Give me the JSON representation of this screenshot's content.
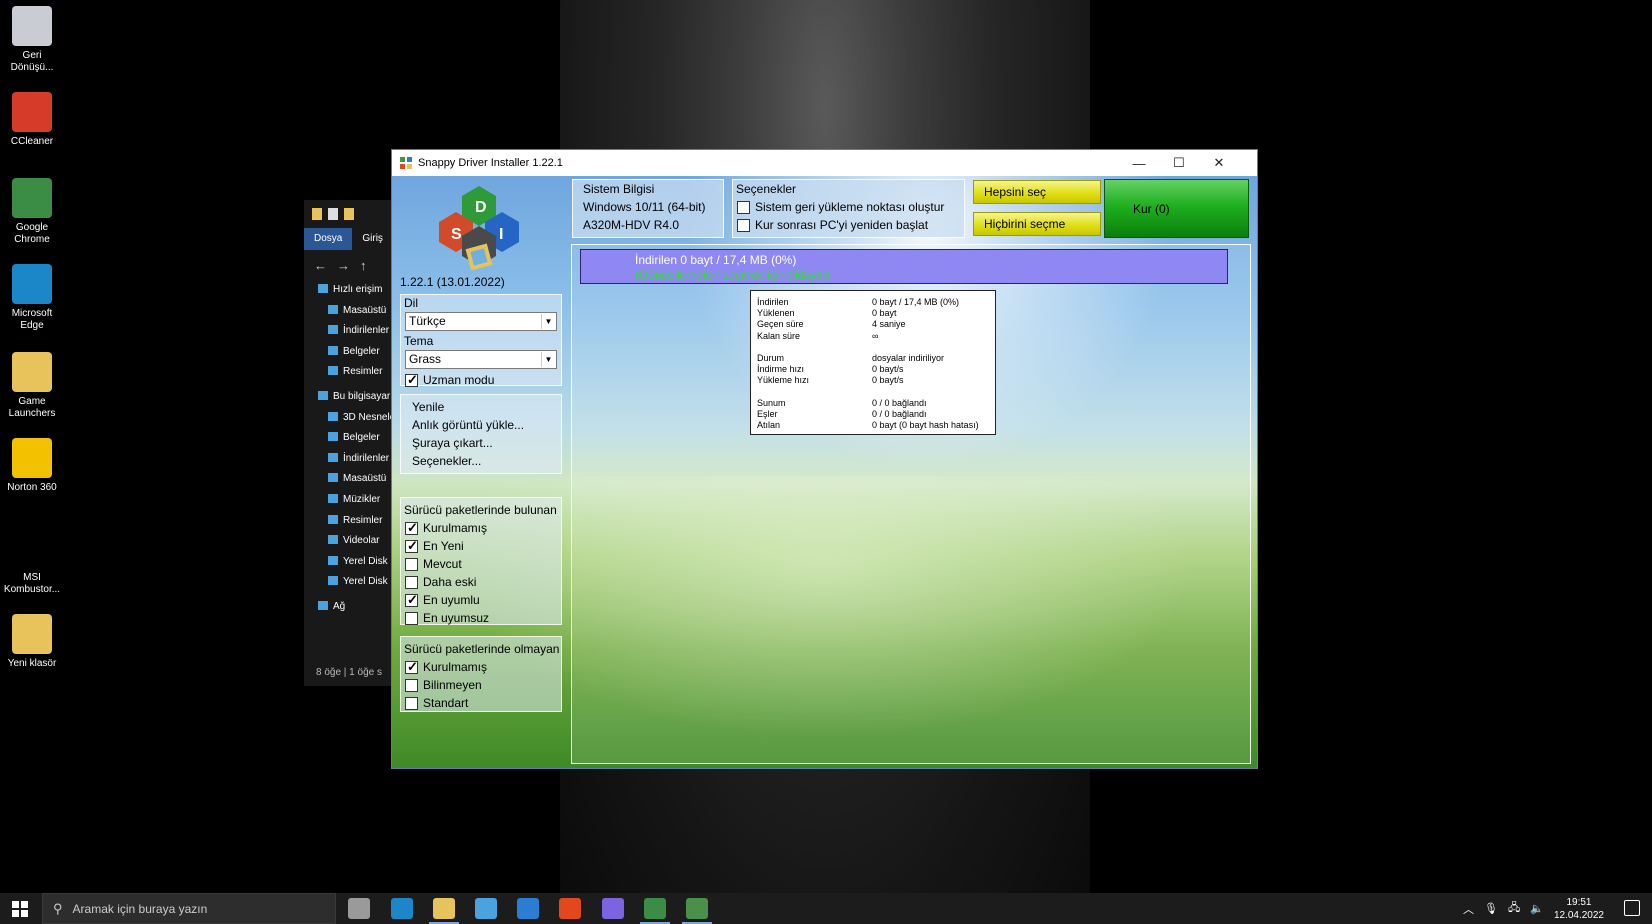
{
  "desktop": {
    "icons": [
      {
        "label": "Geri Dönüşü...",
        "color": "#c9ccd2"
      },
      {
        "label": "CCleaner",
        "color": "#d63b2a"
      },
      {
        "label": "Google Chrome",
        "color": "#3b8d45"
      },
      {
        "label": "Microsoft Edge",
        "color": "#1b87c9"
      },
      {
        "label": "Game Launchers",
        "color": "#e8c25a"
      },
      {
        "label": "Norton 360",
        "color": "#f2c200"
      },
      {
        "label": "MSI Kombustor...",
        "color": "#000000"
      },
      {
        "label": "Yeni klasör",
        "color": "#e8c25a"
      }
    ]
  },
  "explorer": {
    "tabs": [
      "Dosya",
      "Giriş"
    ],
    "tree": [
      {
        "label": "Hızlı erişim",
        "level": 0
      },
      {
        "label": "Masaüstü",
        "level": 1
      },
      {
        "label": "İndirilenler",
        "level": 1
      },
      {
        "label": "Belgeler",
        "level": 1
      },
      {
        "label": "Resimler",
        "level": 1
      },
      {
        "label": "Bu bilgisayar",
        "level": 0
      },
      {
        "label": "3D Nesneler",
        "level": 1
      },
      {
        "label": "Belgeler",
        "level": 1
      },
      {
        "label": "İndirilenler",
        "level": 1
      },
      {
        "label": "Masaüstü",
        "level": 1
      },
      {
        "label": "Müzikler",
        "level": 1
      },
      {
        "label": "Resimler",
        "level": 1
      },
      {
        "label": "Videolar",
        "level": 1
      },
      {
        "label": "Yerel Disk",
        "level": 1
      },
      {
        "label": "Yerel Disk",
        "level": 1
      },
      {
        "label": "Ağ",
        "level": 0
      }
    ],
    "status": "8 öğe  |  1 öğe s"
  },
  "sdi": {
    "title": "Snappy Driver Installer 1.22.1",
    "version": "1.22.1 (13.01.2022)",
    "language": {
      "label": "Dil",
      "value": "Türkçe"
    },
    "theme": {
      "label": "Tema",
      "value": "Grass"
    },
    "expert_mode": {
      "label": "Uzman modu",
      "checked": true
    },
    "menu": [
      "Yenile",
      "Anlık görüntü yükle...",
      "Şuraya çıkart...",
      "Seçenekler..."
    ],
    "found_section": {
      "title": "Sürücü paketlerinde bulunan",
      "items": [
        {
          "label": "Kurulmamış",
          "checked": true
        },
        {
          "label": "En Yeni",
          "checked": true
        },
        {
          "label": "Mevcut",
          "checked": false
        },
        {
          "label": "Daha eski",
          "checked": false
        },
        {
          "label": "En uyumlu",
          "checked": true
        },
        {
          "label": "En uyumsuz",
          "checked": false
        }
      ]
    },
    "missing_section": {
      "title": "Sürücü paketlerinde olmayan",
      "items": [
        {
          "label": "Kurulmamış",
          "checked": true
        },
        {
          "label": "Bilinmeyen",
          "checked": false
        },
        {
          "label": "Standart",
          "checked": false
        }
      ]
    },
    "system_info": {
      "title": "Sistem Bilgisi",
      "os": "Windows 10/11 (64-bit)",
      "board": "A320M-HDV R4.0"
    },
    "options": {
      "title": "Seçenekler",
      "restore_point": {
        "label": "Sistem geri yükleme noktası oluştur",
        "checked": false
      },
      "restart": {
        "label": "Kur sonrası PC'yi yeniden başlat",
        "checked": false
      }
    },
    "select_all": "Hepsini seç",
    "select_none": "Hiçbirini seçme",
    "install": "Kur (0)",
    "progress": {
      "line1": "İndirilen 0 bayt / 17,4 MB (0%)",
      "line2": "(Güncellemeleri seçmek için tıklayın)"
    },
    "stats": [
      {
        "k": "İndirilen",
        "v": "0 bayt / 17,4 MB (0%)"
      },
      {
        "k": "Yüklenen",
        "v": "0 bayt"
      },
      {
        "k": "Geçen süre",
        "v": "4 saniye"
      },
      {
        "k": "Kalan süre",
        "v": "∞"
      },
      {
        "gap": true
      },
      {
        "k": "Durum",
        "v": "dosyalar indiriliyor"
      },
      {
        "k": "İndirme hızı",
        "v": "0 bayt/s"
      },
      {
        "k": "Yükleme hızı",
        "v": "0 bayt/s"
      },
      {
        "gap": true
      },
      {
        "k": "Sunum",
        "v": "0 / 0 bağlandı"
      },
      {
        "k": "Eşler",
        "v": "0 / 0 bağlandı"
      },
      {
        "k": "Atılan",
        "v": "0 bayt (0 bayt hash hatası)"
      }
    ]
  },
  "taskbar": {
    "search_placeholder": "Aramak için buraya yazın",
    "apps": [
      {
        "name": "task-view",
        "color": "#9a9a9a"
      },
      {
        "name": "edge",
        "color": "#1b87c9"
      },
      {
        "name": "file-explorer",
        "color": "#e8c25a"
      },
      {
        "name": "store",
        "color": "#4aa3df"
      },
      {
        "name": "mail",
        "color": "#2b7cd3"
      },
      {
        "name": "office",
        "color": "#e3471d"
      },
      {
        "name": "discord",
        "color": "#7c63e0"
      },
      {
        "name": "chrome",
        "color": "#3b8d45"
      },
      {
        "name": "sdi",
        "color": "#4a8f4a"
      }
    ],
    "time": "19:51",
    "date": "12.04.2022"
  }
}
